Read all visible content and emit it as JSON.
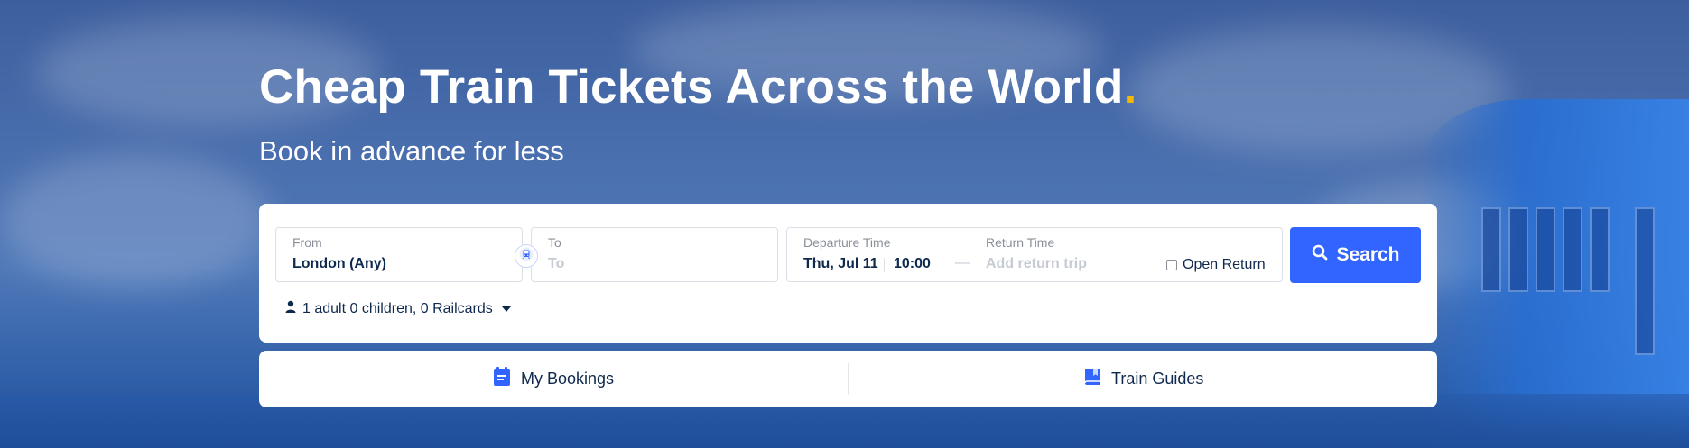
{
  "hero": {
    "title": "Cheap Train Tickets Across the World",
    "title_dot": ".",
    "subtitle": "Book in advance for less"
  },
  "search": {
    "from_label": "From",
    "from_value": "London (Any)",
    "to_label": "To",
    "to_placeholder": "To",
    "departure_label": "Departure Time",
    "departure_date": "Thu, Jul 11",
    "departure_time": "10:00",
    "return_label": "Return Time",
    "return_placeholder": "Add return trip",
    "open_return_label": "Open Return",
    "open_return_checked": false,
    "search_button": "Search",
    "passengers": "1 adult 0 children, 0 Railcards"
  },
  "links": {
    "my_bookings": "My Bookings",
    "train_guides": "Train Guides"
  },
  "colors": {
    "accent": "#3264ff",
    "title_dot": "#f5b800",
    "text_dark": "#0f294d"
  },
  "icons": {
    "swap": "swap-train-icon",
    "search": "search-icon",
    "passenger": "person-icon",
    "bookings": "bookings-icon",
    "guides": "book-icon"
  }
}
